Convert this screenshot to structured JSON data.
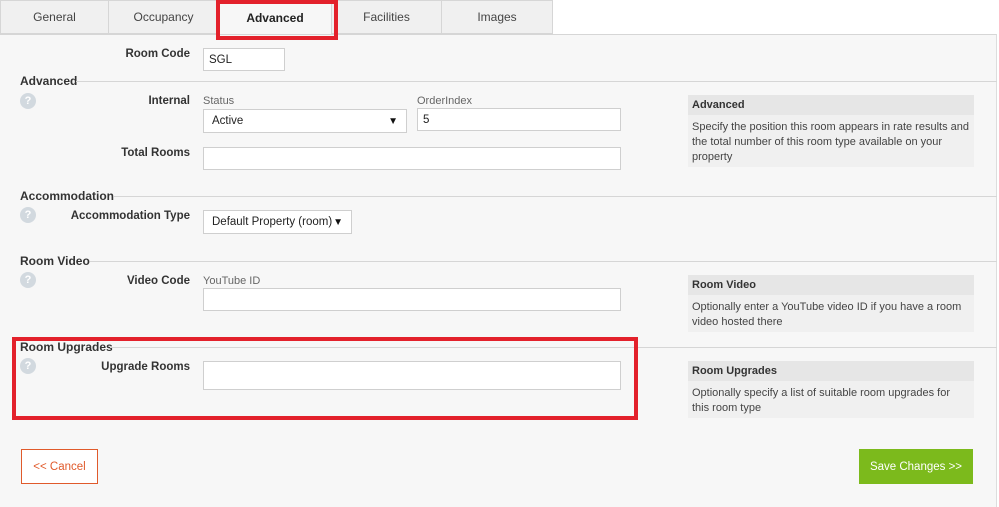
{
  "tabs": [
    {
      "label": "General"
    },
    {
      "label": "Occupancy"
    },
    {
      "label": "Advanced",
      "active": true
    },
    {
      "label": "Facilities"
    },
    {
      "label": "Images"
    }
  ],
  "room_code": {
    "label": "Room Code",
    "value": "SGL"
  },
  "advanced": {
    "title": "Advanced",
    "internal_label": "Internal",
    "status_label": "Status",
    "status_value": "Active",
    "order_index_label": "OrderIndex",
    "order_index_value": "5",
    "total_rooms_label": "Total Rooms",
    "total_rooms_value": "",
    "info_title": "Advanced",
    "info_text": "Specify the position this room appears in rate results and the total number of this room type available on your property"
  },
  "accommodation": {
    "title": "Accommodation",
    "type_label": "Accommodation Type",
    "type_value": "Default Property (room)"
  },
  "room_video": {
    "title": "Room Video",
    "video_code_label": "Video Code",
    "youtube_label": "YouTube ID",
    "youtube_value": "",
    "info_title": "Room Video",
    "info_text": "Optionally enter a YouTube video ID if you have a room video hosted there"
  },
  "room_upgrades": {
    "title": "Room Upgrades",
    "upgrade_rooms_label": "Upgrade Rooms",
    "upgrade_rooms_value": "",
    "info_title": "Room Upgrades",
    "info_text": "Optionally specify a list of suitable room upgrades for this room type"
  },
  "buttons": {
    "cancel": "<< Cancel",
    "save": "Save Changes >>"
  },
  "icons": {
    "help": "?",
    "dropdown": "▼"
  },
  "colors": {
    "highlight": "#e3212b",
    "save": "#7cba1c",
    "cancel": "#e05a2b"
  }
}
